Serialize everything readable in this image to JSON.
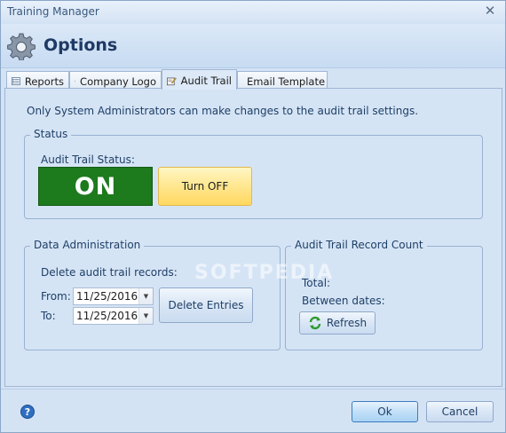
{
  "window": {
    "title": "Training Manager"
  },
  "header": {
    "title": "Options"
  },
  "tabs": [
    {
      "label": "Reports",
      "icon": "list-icon"
    },
    {
      "label": "Company Logo",
      "icon": "image-icon"
    },
    {
      "label": "Audit Trail",
      "icon": "edit-icon"
    },
    {
      "label": "Email Template",
      "icon": "envelope-icon"
    }
  ],
  "audit": {
    "info": "Only System Administrators can make changes to the audit trail settings.",
    "status_group": "Status",
    "status_label": "Audit Trail Status:",
    "status_value": "ON",
    "toggle_button": "Turn OFF",
    "watermark": "SOFTPEDIA"
  },
  "data_admin": {
    "group": "Data Administration",
    "delete_label": "Delete audit trail records:",
    "from_label": "From:",
    "to_label": "To:",
    "from_date": "11/25/2016",
    "to_date": "11/25/2016",
    "delete_button": "Delete Entries"
  },
  "record_count": {
    "group": "Audit Trail Record Count",
    "total_label": "Total:",
    "between_label": "Between dates:",
    "refresh_button": "Refresh"
  },
  "footer": {
    "ok_button": "Ok",
    "cancel_button": "Cancel"
  },
  "colors": {
    "on_green": "#1d7a1d",
    "toggle_yellow": "#ffe58a",
    "window_blue": "#d5e4f5"
  }
}
